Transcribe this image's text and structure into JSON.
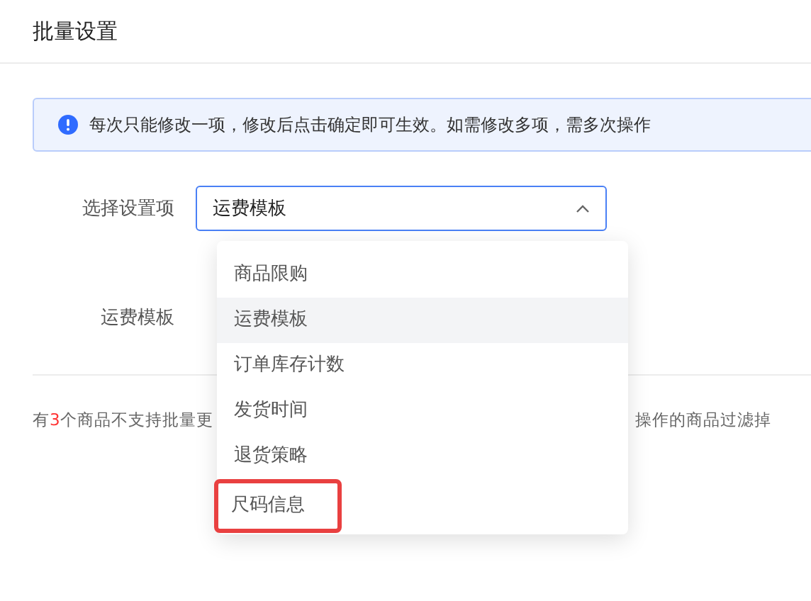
{
  "title": "批量设置",
  "alert": {
    "text": "每次只能修改一项，修改后点击确定即可生效。如需修改多项，需多次操作"
  },
  "form": {
    "rows": [
      {
        "label": "选择设置项",
        "kind": "select",
        "value": "运费模板",
        "expanded": true
      },
      {
        "label": "运费模板",
        "kind": "blank"
      }
    ]
  },
  "notice": {
    "prefix": "有",
    "count": "3",
    "suffix": "个商品不支持批量更",
    "tail": "操作的商品过滤掉"
  },
  "dropdown": {
    "options": [
      {
        "label": "商品限购",
        "selected": false,
        "annotated": false
      },
      {
        "label": "运费模板",
        "selected": true,
        "annotated": false
      },
      {
        "label": "订单库存计数",
        "selected": false,
        "annotated": false
      },
      {
        "label": "发货时间",
        "selected": false,
        "annotated": false
      },
      {
        "label": "退货策略",
        "selected": false,
        "annotated": false
      },
      {
        "label": "尺码信息",
        "selected": false,
        "annotated": true
      }
    ]
  }
}
